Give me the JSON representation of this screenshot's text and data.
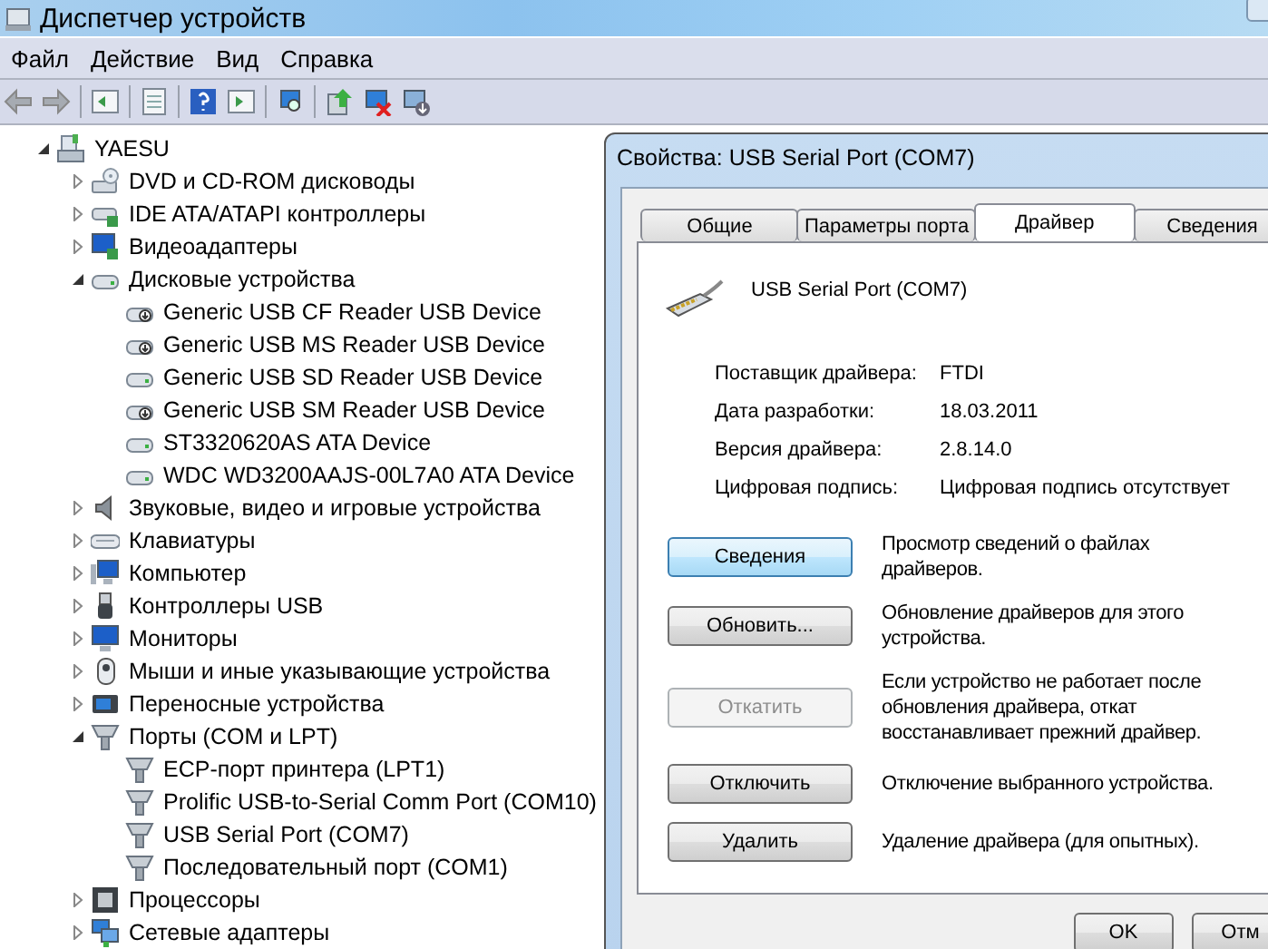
{
  "window": {
    "title": "Диспетчер устройств"
  },
  "menu": [
    "Файл",
    "Действие",
    "Вид",
    "Справка"
  ],
  "tree": [
    {
      "label": "YAESU",
      "kind": "computer",
      "expanded": true,
      "children": [
        {
          "label": "DVD и CD-ROM дисководы",
          "kind": "dvd",
          "expanded": false
        },
        {
          "label": "IDE ATA/ATAPI контроллеры",
          "kind": "ide",
          "expanded": false
        },
        {
          "label": "Видеоадаптеры",
          "kind": "display",
          "expanded": false
        },
        {
          "label": "Дисковые устройства",
          "kind": "disk",
          "expanded": true,
          "children": [
            {
              "label": "Generic USB CF Reader USB Device",
              "kind": "reader"
            },
            {
              "label": "Generic USB MS Reader USB Device",
              "kind": "reader"
            },
            {
              "label": "Generic USB SD Reader USB Device",
              "kind": "disk"
            },
            {
              "label": "Generic USB SM Reader USB Device",
              "kind": "reader"
            },
            {
              "label": "ST3320620AS ATA Device",
              "kind": "disk"
            },
            {
              "label": "WDC WD3200AAJS-00L7A0 ATA Device",
              "kind": "disk"
            }
          ]
        },
        {
          "label": "Звуковые, видео и игровые устройства",
          "kind": "sound",
          "expanded": false
        },
        {
          "label": "Клавиатуры",
          "kind": "keyboard",
          "expanded": false
        },
        {
          "label": "Компьютер",
          "kind": "pc",
          "expanded": false
        },
        {
          "label": "Контроллеры USB",
          "kind": "usb",
          "expanded": false
        },
        {
          "label": "Мониторы",
          "kind": "monitor",
          "expanded": false
        },
        {
          "label": "Мыши и иные указывающие устройства",
          "kind": "mouse",
          "expanded": false
        },
        {
          "label": "Переносные устройства",
          "kind": "portable",
          "expanded": false
        },
        {
          "label": "Порты (COM и LPT)",
          "kind": "port",
          "expanded": true,
          "children": [
            {
              "label": "ECP-порт принтера (LPT1)",
              "kind": "port"
            },
            {
              "label": "Prolific USB-to-Serial Comm Port (COM10)",
              "kind": "port"
            },
            {
              "label": "USB Serial Port (COM7)",
              "kind": "port"
            },
            {
              "label": "Последовательный порт (COM1)",
              "kind": "port"
            }
          ]
        },
        {
          "label": "Процессоры",
          "kind": "cpu",
          "expanded": false
        },
        {
          "label": "Сетевые адаптеры",
          "kind": "network",
          "expanded": false
        }
      ]
    }
  ],
  "dialog": {
    "title": "Свойства: USB Serial Port (COM7)",
    "tabs": [
      {
        "label": "Общие",
        "selected": false
      },
      {
        "label": "Параметры порта",
        "selected": false
      },
      {
        "label": "Драйвер",
        "selected": true
      },
      {
        "label": "Сведения",
        "selected": false
      }
    ],
    "device_name": "USB Serial Port (COM7)",
    "info": [
      {
        "label": "Поставщик драйвера:",
        "value": "FTDI"
      },
      {
        "label": "Дата разработки:",
        "value": "18.03.2011"
      },
      {
        "label": "Версия драйвера:",
        "value": "2.8.14.0"
      },
      {
        "label": "Цифровая подпись:",
        "value": "Цифровая подпись отсутствует"
      }
    ],
    "actions": [
      {
        "button": "Сведения",
        "description": "Просмотр сведений о файлах драйверов.",
        "disabled": false,
        "focused": true
      },
      {
        "button": "Обновить...",
        "description": "Обновление драйверов для этого устройства.",
        "disabled": false,
        "focused": false
      },
      {
        "button": "Откатить",
        "description": "Если устройство не работает после обновления драйвера, откат восстанавливает прежний драйвер.",
        "disabled": true,
        "focused": false
      },
      {
        "button": "Отключить",
        "description": "Отключение выбранного устройства.",
        "disabled": false,
        "focused": false
      },
      {
        "button": "Удалить",
        "description": "Удаление драйвера (для опытных).",
        "disabled": false,
        "focused": false
      }
    ],
    "footer_buttons": [
      "OK",
      "Отм"
    ]
  }
}
